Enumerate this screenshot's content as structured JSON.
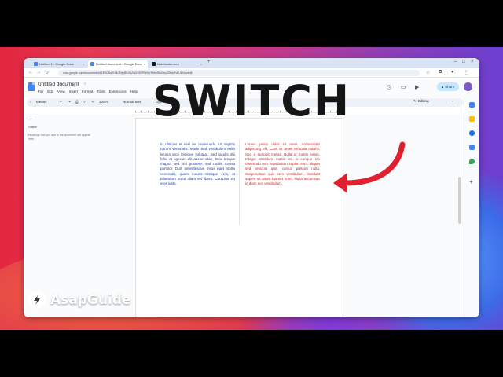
{
  "browser": {
    "tabs": [
      {
        "title": "Untitled 1 - Google Docs",
        "favicon_color": "#4285f4"
      },
      {
        "title": "Untitled document - Google Docs",
        "favicon_color": "#4285f4"
      },
      {
        "title": "Notebooks.com",
        "favicon_color": "#1a1a1a"
      }
    ],
    "new_tab": "+",
    "url": "docs.google.com/document/d/1ZE5CNdZHl4LTMyB0VNZWZXfOPhK0YRMmRlzXXpJZfnwRvLUbXLa/edit"
  },
  "docs": {
    "title": "Untitled document",
    "menu": [
      "File",
      "Edit",
      "View",
      "Insert",
      "Format",
      "Tools",
      "Extensions",
      "Help"
    ],
    "share_label": "Share",
    "toolbar": {
      "search": "Menus",
      "zoom": "100%",
      "style": "Normal text",
      "font": "Open",
      "mode": "Editing"
    },
    "outline": {
      "back": "←",
      "title": "Outline",
      "hint": "Headings that you add to the document will appear here."
    },
    "left_column": "In ultricies et erat vel malesuada. Ut sagittis rutrum venenatis. Morbi Sed vestibulum enim lacinia arcu tristique volutpat. Sed iaculis dui felis, et egestas elit auctor vitae. Cras tempor magna sed nisl posuere, sed mollis massa porttitor. Duis pellentesque, risus eget mollis venenatis, quam mauris tristique eros, at bibendum purus diam vel libero. Curabitur eu eros justo.",
    "right_column": "Lorem ipsum dolor sit amet, consectetur adipiscing elit. Cras sit amet vehicula mauris. Sed a suscipit metus. Nulla id mattis lorem. Integer interdum mattis mi, a congue leo commodo non. Vestibulum sapien sem, aliquet sed vehicula quis, cursus pretium nulla. Suspendisse quis sem vestibulum, tincidunt sapien sit amet, laoreet nunc. Nulla accumsan in diam nec vestibulum."
  },
  "overlay": {
    "headline": "SWITCH",
    "brand": "AsapGuide"
  },
  "colors": {
    "left_text": "#1a3a9c",
    "right_text": "#c62828",
    "arrow": "#e0202e",
    "share_bg": "#c2e7ff"
  }
}
